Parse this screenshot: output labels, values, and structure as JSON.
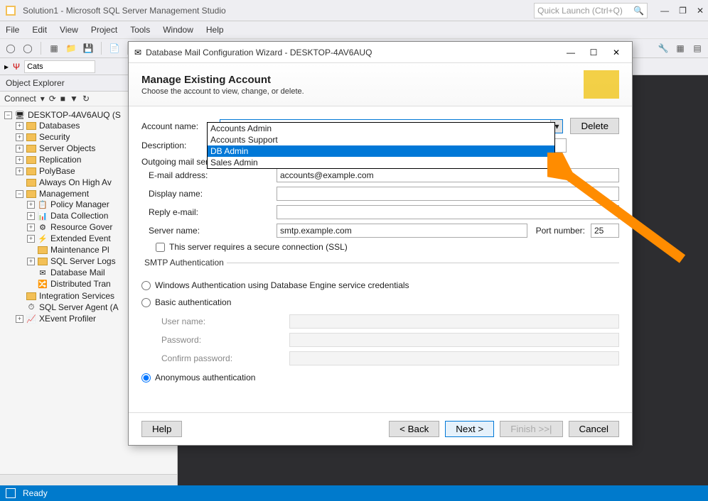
{
  "window": {
    "title": "Solution1 - Microsoft SQL Server Management Studio",
    "quick_launch_placeholder": "Quick Launch (Ctrl+Q)"
  },
  "menu": [
    "File",
    "Edit",
    "View",
    "Project",
    "Tools",
    "Window",
    "Help"
  ],
  "toolbar2_input": "Cats",
  "object_explorer": {
    "title": "Object Explorer",
    "connect_label": "Connect",
    "root": "DESKTOP-4AV6AUQ (S",
    "nodes": [
      "Databases",
      "Security",
      "Server Objects",
      "Replication",
      "PolyBase",
      "Always On High Av"
    ],
    "management": "Management",
    "management_children": [
      "Policy Manager",
      "Data Collection",
      "Resource Gover",
      "Extended Event",
      "Maintenance Pl",
      "SQL Server Logs",
      "Database Mail",
      "Distributed Tran"
    ],
    "tail": [
      "Integration Services",
      "SQL Server Agent (A",
      "XEvent Profiler"
    ]
  },
  "dialog": {
    "title": "Database Mail Configuration Wizard - DESKTOP-4AV6AUQ",
    "heading": "Manage Existing Account",
    "subheading": "Choose the account to view, change, or delete.",
    "labels": {
      "account_name": "Account name:",
      "description": "Description:",
      "outgoing": "Outgoing mail server (S",
      "email": "E-mail address:",
      "display": "Display name:",
      "reply": "Reply e-mail:",
      "server": "Server name:",
      "port": "Port number:",
      "ssl": "This server requires a secure connection (SSL)",
      "smtp_auth": "SMTP Authentication",
      "auth_win": "Windows Authentication using Database Engine service credentials",
      "auth_basic": "Basic authentication",
      "user": "User name:",
      "pass": "Password:",
      "confirm": "Confirm password:",
      "auth_anon": "Anonymous authentication"
    },
    "values": {
      "account_name": "Accounts Admin",
      "email": "accounts@example.com",
      "server": "smtp.example.com",
      "port": "25"
    },
    "dropdown_options": [
      "Accounts Admin",
      "Accounts Support",
      "DB Admin",
      "Sales Admin"
    ],
    "dropdown_highlight_index": 2,
    "buttons": {
      "delete": "Delete",
      "help": "Help",
      "back": "< Back",
      "next": "Next >",
      "finish": "Finish >>|",
      "cancel": "Cancel"
    }
  },
  "statusbar": {
    "ready": "Ready"
  }
}
